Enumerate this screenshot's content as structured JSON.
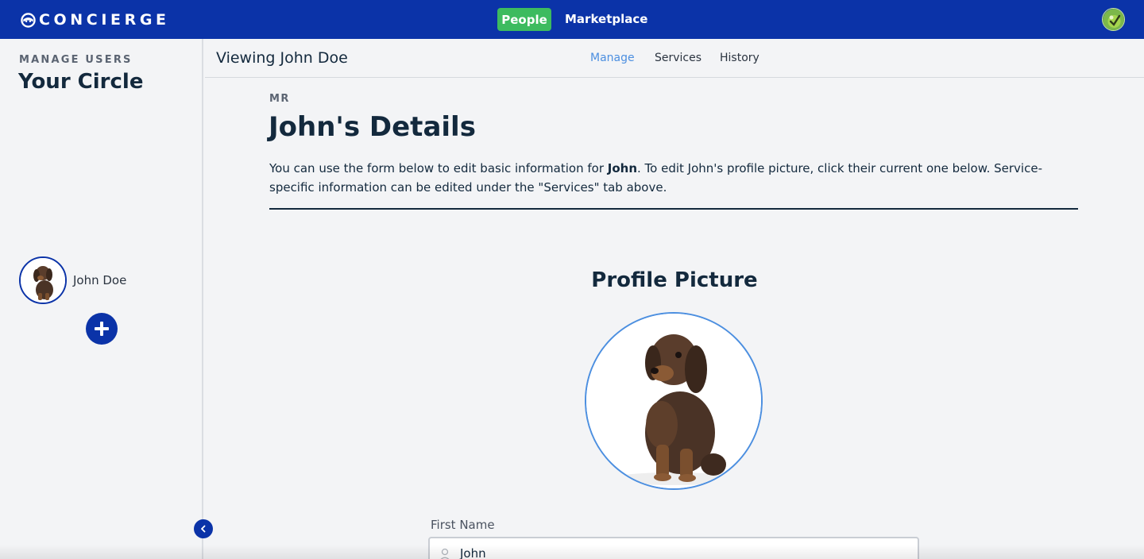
{
  "topbar": {
    "brand": "CONCIERGE",
    "nav": [
      {
        "label": "People",
        "active": true
      },
      {
        "label": "Marketplace",
        "active": false
      }
    ]
  },
  "sidebar": {
    "eyebrow": "MANAGE USERS",
    "title": "Your Circle",
    "users": [
      {
        "name": "John Doe",
        "avatar": "puppy-photo"
      }
    ]
  },
  "subheader": {
    "viewing": "Viewing John Doe",
    "tabs": [
      {
        "label": "Manage",
        "active": true
      },
      {
        "label": "Services",
        "active": false
      },
      {
        "label": "History",
        "active": false
      }
    ]
  },
  "main": {
    "eyebrow": "MR",
    "title": "John's Details",
    "description_pre": "You can use the form below to edit basic information for ",
    "description_bold": "John",
    "description_post": ". To edit John's profile picture, click their current one below. Service-specific information can be edited under the \"Services\" tab above.",
    "profile_heading": "Profile Picture",
    "first_name_label": "First Name",
    "first_name_value": "John"
  },
  "colors": {
    "brand": "#0b33a8",
    "people_active": "#3dbb5f",
    "tab_active": "#4c8fe0",
    "heading": "#13293d"
  }
}
